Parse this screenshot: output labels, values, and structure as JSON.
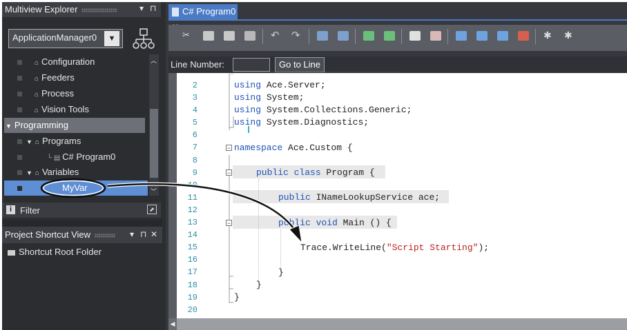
{
  "explorer": {
    "title": "Multiview Explorer",
    "pin": "⊓",
    "menu_arrow": "▾",
    "app_combo": "ApplicationManager0",
    "combo_arrow": "▼",
    "tree": {
      "configuration": "Configuration",
      "feeders": "Feeders",
      "process": "Process",
      "vision_tools": "Vision Tools",
      "programming": "Programming",
      "programs": "Programs",
      "program0": "C# Program0",
      "variables": "Variables",
      "myvar": "MyVar"
    },
    "filter_label": "Filter"
  },
  "shortcut_view": {
    "title": "Project Shortcut View",
    "close": "✕",
    "root_folder": "Shortcut Root Folder"
  },
  "editor": {
    "tab_title": "C# Program0",
    "tab_close": "✕",
    "line_number_label": "Line Number:",
    "line_number_value": "",
    "goto_label": "Go to Line",
    "line_numbers": [
      "2",
      "3",
      "4",
      "5",
      "6",
      "7",
      "8",
      "9",
      "10",
      "11",
      "12",
      "13",
      "14",
      "15",
      "16",
      "17",
      "18",
      "19",
      "20"
    ],
    "code": {
      "l1_kw": "using",
      "l1_rest": " Ace.Server;",
      "l2_kw": "using",
      "l2_rest": " System;",
      "l3_kw": "using",
      "l3_rest": " System.Collections.Generic;",
      "l4_kw": "using",
      "l4_rest": " System.Diagnostics;",
      "l5_kw": "namespace",
      "l5_rest": " Ace.Custom {",
      "l6_kw": "public class",
      "l6_rest": " Program {",
      "l7_kw": "public",
      "l7_rest": " INameLookupService ace;",
      "l8_kw": "public void",
      "l8_rest": " Main () {",
      "l9_pre": "Trace.WriteLine(",
      "l9_str": "\"Script Starting\"",
      "l9_post": ");",
      "close_brace": "}"
    }
  },
  "icons": [
    "cut-icon",
    "copy-icon",
    "paste-icon",
    "delete-icon",
    "undo-icon",
    "redo-icon",
    "outdent-icon",
    "indent-icon",
    "comment-icon",
    "uncomment-icon",
    "breakpoint-hand-icon",
    "clear-breakpoint-icon",
    "window-icon",
    "bookmark-icon",
    "bookmark-next-icon",
    "bookmark-clear-icon",
    "settings-icon",
    "settings2-icon"
  ],
  "colors": {
    "accent": "#4b7bc4",
    "selection": "#5e8ed4",
    "keyword": "#1f52b5",
    "string": "#b8231b",
    "line_number": "#2d8fa6"
  }
}
